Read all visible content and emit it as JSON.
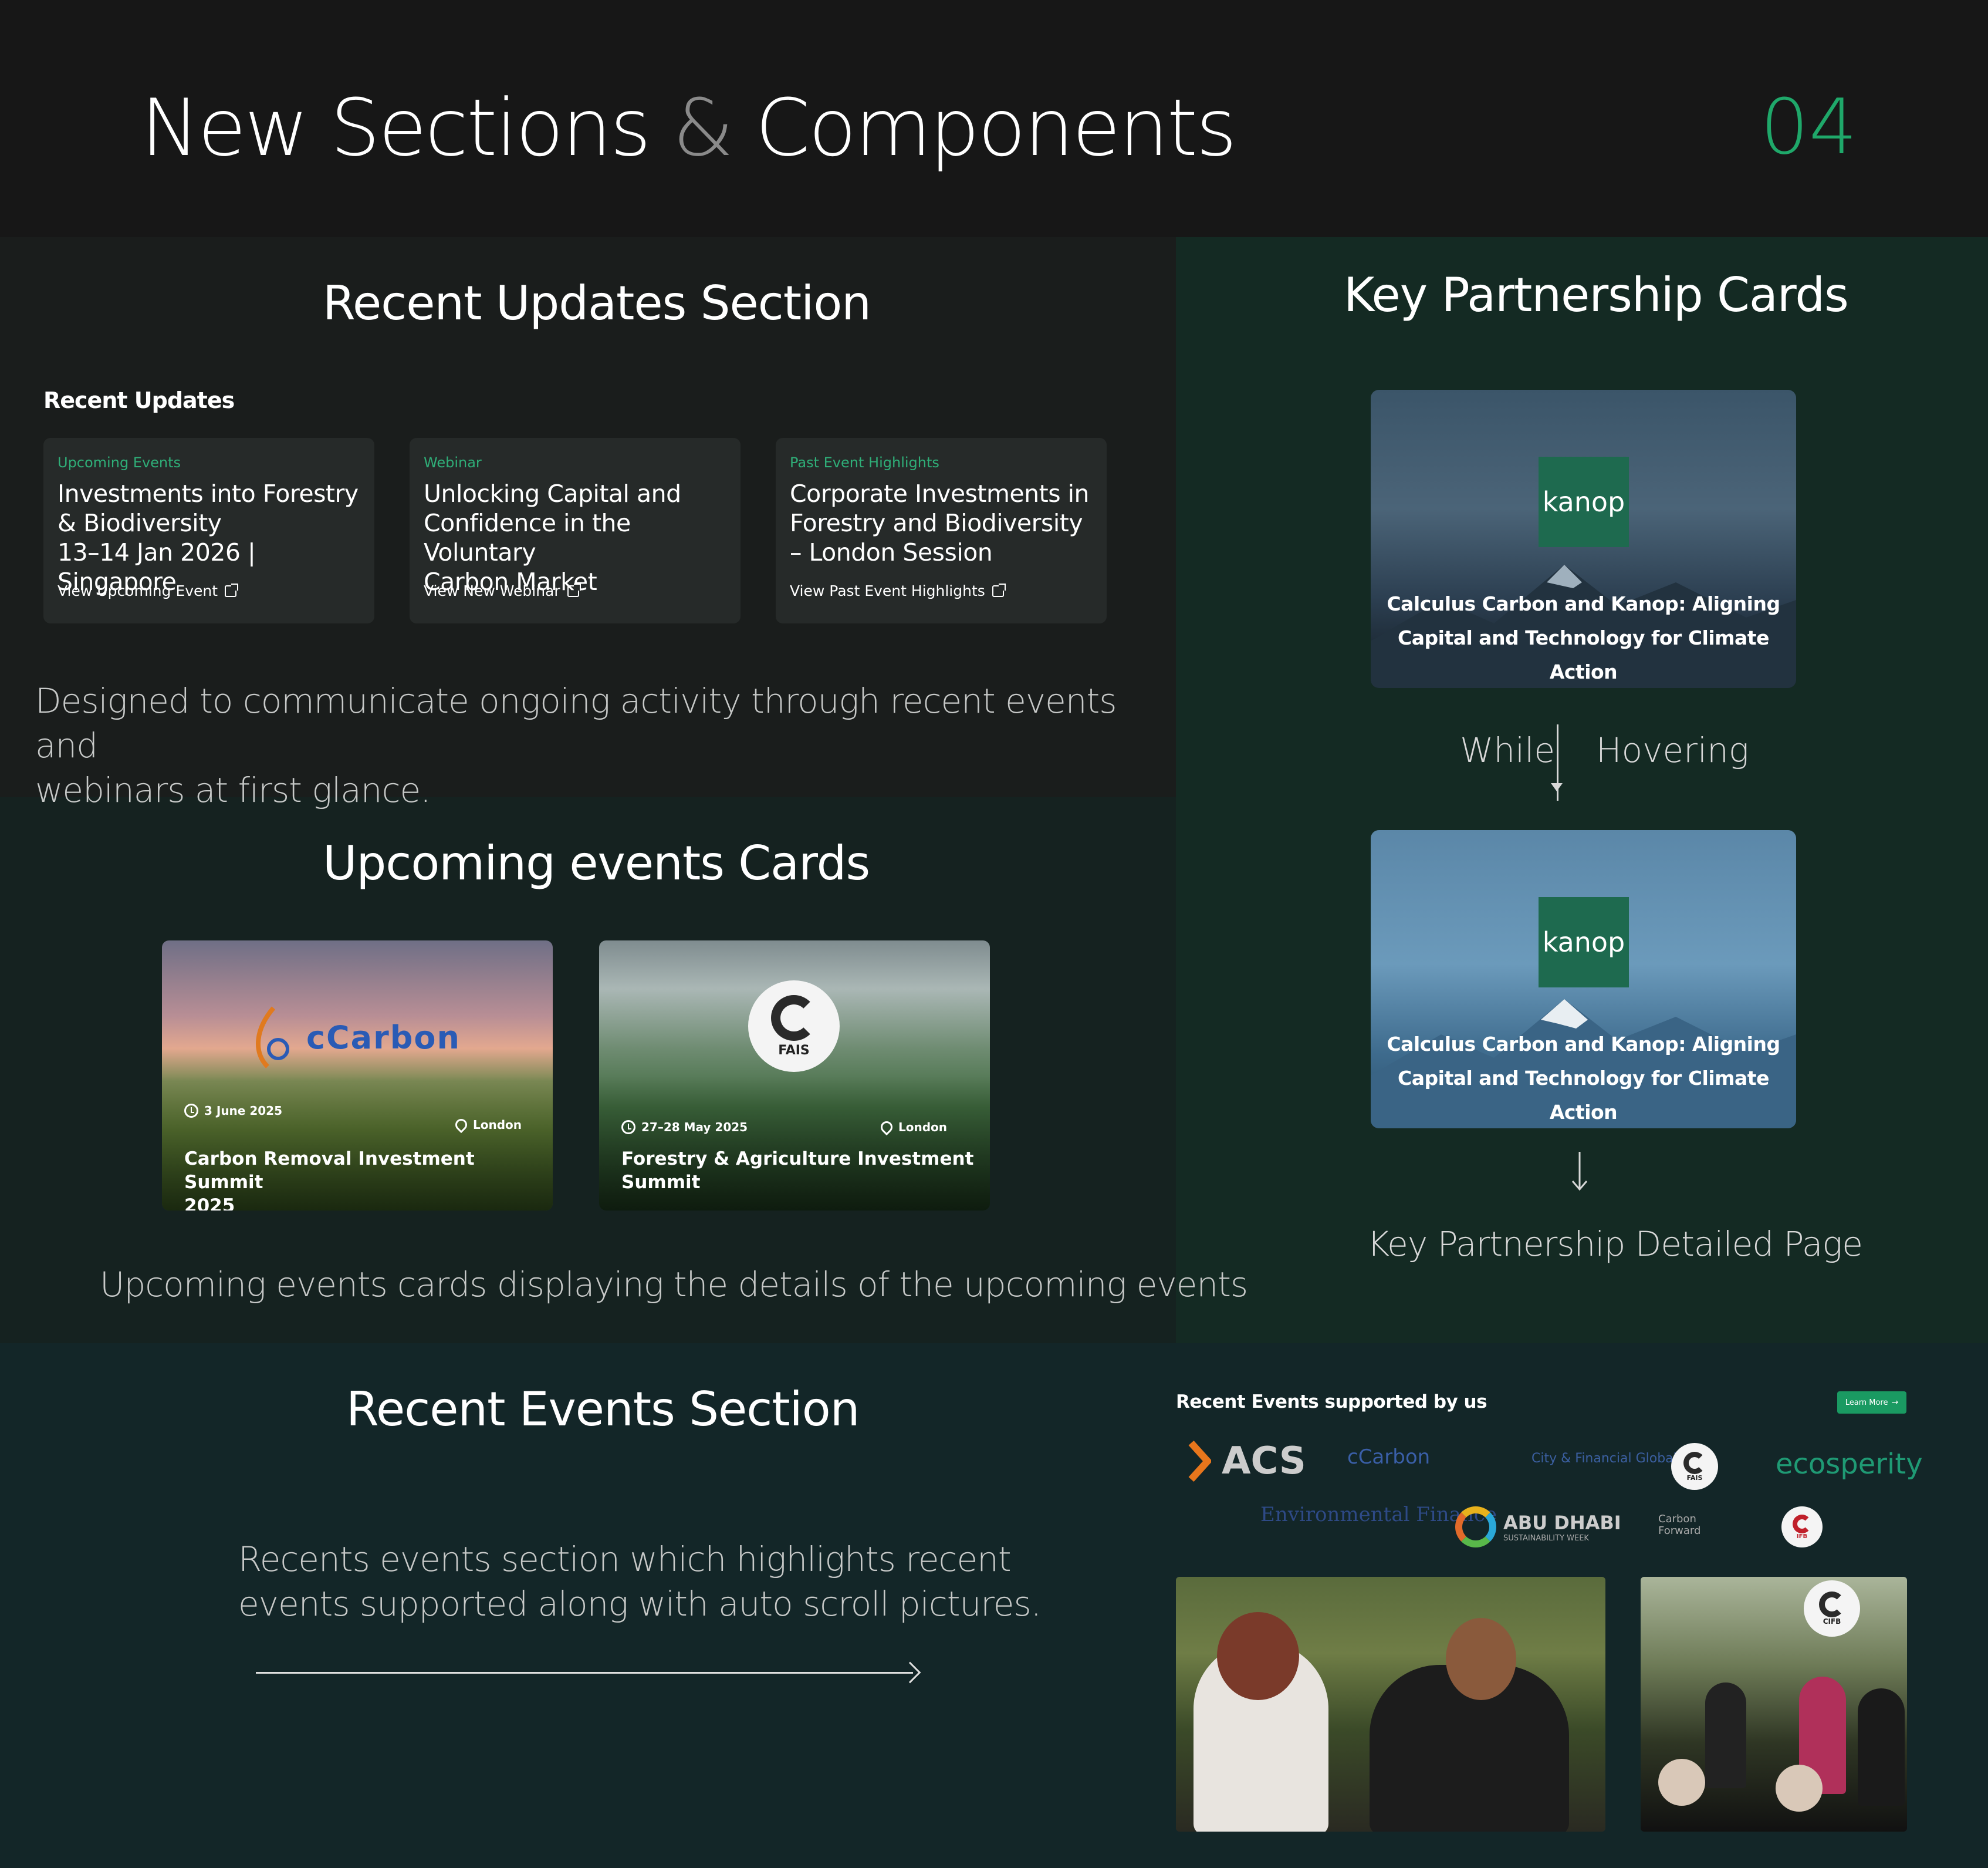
{
  "header": {
    "title_part1": "New Sections",
    "title_amp": "&",
    "title_part2": "Components",
    "number": "04"
  },
  "recent_updates": {
    "section_title": "Recent Updates Section",
    "heading": "Recent Updates",
    "cards": [
      {
        "category": "Upcoming Events",
        "title_lines": [
          "Investments into Forestry",
          "& Biodiversity",
          "13–14 Jan 2026 | Singapore"
        ],
        "link": "View Upcoming Event"
      },
      {
        "category": "Webinar",
        "title_lines": [
          "Unlocking Capital and",
          "Confidence in the Voluntary",
          "Carbon Market"
        ],
        "link": "View New Webinar"
      },
      {
        "category": "Past Event Highlights",
        "title_lines": [
          "Corporate Investments in",
          "Forestry and Biodiversity",
          "– London Session"
        ],
        "link": "View Past Event Highlights"
      }
    ],
    "description_lines": [
      "Designed to communicate ongoing activity through recent events and",
      "webinars at first glance."
    ]
  },
  "upcoming_events": {
    "section_title": "Upcoming events Cards",
    "cards": [
      {
        "logo": "cCarbon",
        "date": "3 June 2025",
        "location": "London",
        "title_lines": [
          "Carbon Removal Investment Summit",
          "2025"
        ]
      },
      {
        "logo": "FAIS",
        "date": "27–28 May 2025",
        "location": "London",
        "title_lines": [
          "Forestry & Agriculture Investment",
          "Summit"
        ]
      }
    ],
    "description": "Upcoming events cards displaying the details of the upcoming events"
  },
  "key_partnership": {
    "section_title": "Key Partnership Cards",
    "logo": "kanop",
    "card_title_lines": [
      "Calculus Carbon and Kanop: Aligning",
      "Capital and Technology for Climate Action"
    ],
    "hover_left": "While",
    "hover_right": "Hovering",
    "detail_label": "Key Partnership Detailed Page"
  },
  "recent_events": {
    "section_title": "Recent Events Section",
    "description_lines": [
      "Recents events section which highlights recent",
      "events supported along with auto scroll  pictures."
    ],
    "supported_heading": "Recent Events supported by us",
    "learn_more": "Learn More",
    "logos_row1": [
      "ACS",
      "cCarbon",
      "City & Financial Global",
      "FAIS",
      "ecosperity"
    ],
    "logos_row2": [
      "Environmental Finance",
      "ABU DHABI",
      "SUSTAINABILITY WEEK",
      "Carbon Forward",
      "IFB"
    ],
    "photo2_badge": "CIFB"
  },
  "colors": {
    "accent": "#1fa86a",
    "card_bg": "#262a29",
    "kanop": "#1e6a4f"
  }
}
